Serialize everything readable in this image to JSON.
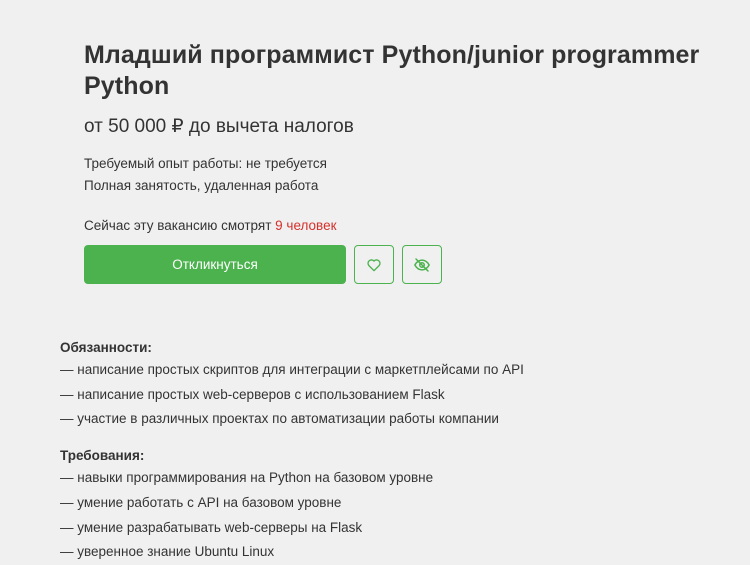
{
  "vacancy": {
    "title": "Младший программист Python/junior programmer Python",
    "salary": "от 50 000 ₽ до вычета налогов",
    "experience": "Требуемый опыт работы: не требуется",
    "employment": "Полная занятость, удаленная работа",
    "viewers_prefix": "Сейчас эту вакансию смотрят ",
    "viewers_count": "9 человек"
  },
  "actions": {
    "respond_label": "Откликнуться",
    "favorite_icon": "heart-icon",
    "hide_icon": "eye-off-icon",
    "accent_color": "#4bb24e"
  },
  "sections": [
    {
      "title": "Обязанности:",
      "items": [
        "— написание простых скриптов для интеграции с маркетплейсами по API",
        "— написание простых web-серверов с использованием Flask",
        "— участие в различных проектах по автоматизации работы компании"
      ]
    },
    {
      "title": "Требования:",
      "items": [
        "— навыки программирования на Python на базовом уровне",
        "— умение работать с API на базовом уровне",
        "— умение разрабатывать web-серверы на Flask",
        "— уверенное знание Ubuntu Linux"
      ]
    }
  ]
}
